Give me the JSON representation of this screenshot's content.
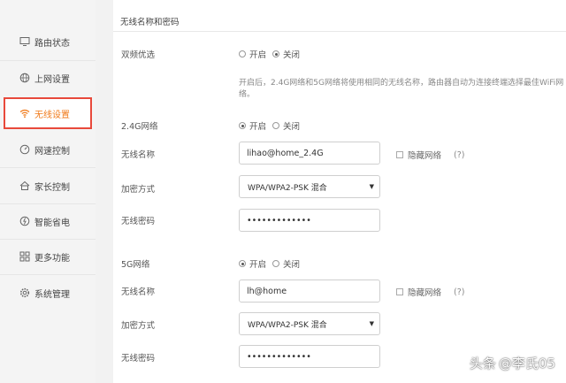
{
  "sidebar": {
    "items": [
      {
        "label": "路由状态",
        "icon": "monitor-icon"
      },
      {
        "label": "上网设置",
        "icon": "globe-icon"
      },
      {
        "label": "无线设置",
        "icon": "wifi-icon",
        "active": true
      },
      {
        "label": "网速控制",
        "icon": "speedometer-icon"
      },
      {
        "label": "家长控制",
        "icon": "family-icon"
      },
      {
        "label": "智能省电",
        "icon": "power-icon"
      },
      {
        "label": "更多功能",
        "icon": "grid-icon"
      },
      {
        "label": "系统管理",
        "icon": "gear-icon"
      }
    ]
  },
  "main": {
    "section_title": "无线名称和密码",
    "dual_band": {
      "label": "双频优选",
      "option_on": "开启",
      "option_off": "关闭",
      "selected": "off",
      "hint": "开启后，2.4G网络和5G网络将使用相同的无线名称，路由器自动为连接终端选择最佳WiFi网络。"
    },
    "band_24g": {
      "label": "2.4G网络",
      "option_on": "开启",
      "option_off": "关闭",
      "selected": "on",
      "ssid_label": "无线名称",
      "ssid_value": "lihao@home_2.4G",
      "hide_label": "隐藏网络",
      "help": "(?)",
      "encryption_label": "加密方式",
      "encryption_value": "WPA/WPA2-PSK 混合",
      "password_label": "无线密码",
      "password_value": "•••••••••••••"
    },
    "band_5g": {
      "label": "5G网络",
      "option_on": "开启",
      "option_off": "关闭",
      "selected": "on",
      "ssid_label": "无线名称",
      "ssid_value": "lh@home",
      "hide_label": "隐藏网络",
      "help": "(?)",
      "encryption_label": "加密方式",
      "encryption_value": "WPA/WPA2-PSK 混合",
      "password_label": "无线密码",
      "password_value": "•••••••••••••"
    }
  },
  "watermark": {
    "prefix": "头条",
    "handle": "@李氏05"
  },
  "colors": {
    "active_text": "#f07a1a",
    "active_border": "#e8493b"
  }
}
